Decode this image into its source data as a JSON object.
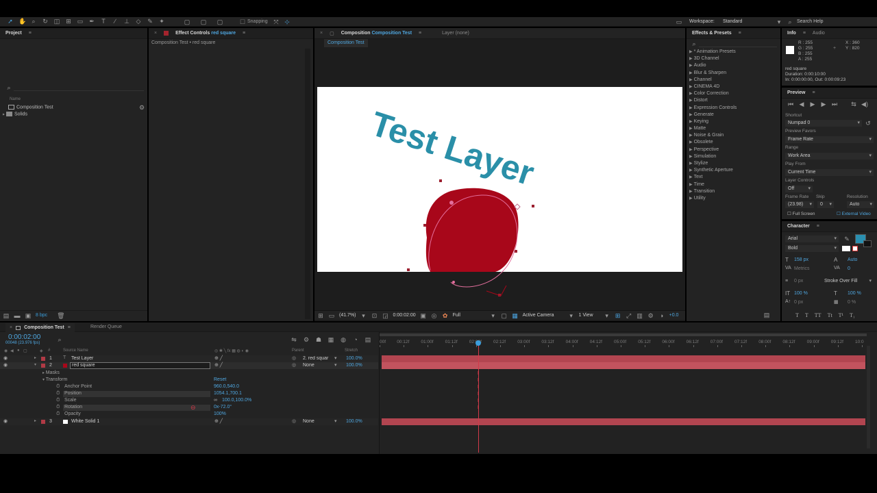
{
  "toolbar": {
    "snapping": "Snapping",
    "workspace_label": "Workspace:",
    "workspace_value": "Standard",
    "search_help": "Search Help"
  },
  "project": {
    "tab": "Project",
    "column_name": "Name",
    "items": [
      "Composition Test",
      "Solids"
    ],
    "bpc": "8 bpc"
  },
  "effect_controls": {
    "tab_prefix": "Effect Controls",
    "tab_layer": "red square",
    "subtitle": "Composition Test • red square"
  },
  "composition": {
    "tab_prefix": "Composition",
    "tab_name": "Composition Test",
    "layer_tab": "Layer (none)",
    "sub_tab": "Composition Test",
    "text_layer": "Test Layer",
    "zoom": "(41.7%)",
    "timecode": "0:00:02:00",
    "resolution": "Full",
    "camera": "Active Camera",
    "view": "1 View",
    "exposure": "+0.0"
  },
  "effects_presets": {
    "tab": "Effects & Presets",
    "items": [
      "* Animation Presets",
      "3D Channel",
      "Audio",
      "Blur & Sharpen",
      "Channel",
      "CINEMA 4D",
      "Color Correction",
      "Distort",
      "Expression Controls",
      "Generate",
      "Keying",
      "Matte",
      "Noise & Grain",
      "Obsolete",
      "Perspective",
      "Simulation",
      "Stylize",
      "Synthetic Aperture",
      "Text",
      "Time",
      "Transition",
      "Utility"
    ]
  },
  "info": {
    "tab": "Info",
    "audio_tab": "Audio",
    "r": "R : 255",
    "g": "G : 255",
    "b": "B : 255",
    "a": "A : 255",
    "x": "X : 360",
    "y": "Y : 820",
    "layer_name": "red square",
    "duration": "Duration: 0:00:10:00",
    "in_out": "In: 0:00:00:00, Out: 0:00:09:23"
  },
  "preview": {
    "tab": "Preview",
    "shortcut_label": "Shortcut",
    "shortcut_value": "Numpad 0",
    "favors_label": "Preview Favors",
    "favors_value": "Frame Rate",
    "range_label": "Range",
    "range_value": "Work Area",
    "play_from_label": "Play From",
    "play_from_value": "Current Time",
    "layer_controls_label": "Layer Controls",
    "layer_controls_value": "Off",
    "frame_rate_label": "Frame Rate",
    "skip_label": "Skip",
    "resolution_label": "Resolution",
    "frame_rate_value": "(23.98)",
    "skip_value": "0",
    "resolution_value": "Auto",
    "full_screen": "Full Screen",
    "external_video": "External Video"
  },
  "character": {
    "tab": "Character",
    "font": "Arial",
    "style": "Bold",
    "size": "158 px",
    "leading": "Auto",
    "kerning": "Metrics",
    "tracking": "0",
    "stroke_width": "0 px",
    "stroke_mode": "Stroke Over Fill",
    "vscale": "100 %",
    "hscale": "100 %",
    "baseline": "0 px",
    "tsume": "0 %",
    "fill_color": "#2a8fb0"
  },
  "timeline": {
    "tab": "Composition Test",
    "render_queue": "Render Queue",
    "timecode": "0:00:02:00",
    "frames": "00048 (23.976 fps)",
    "headers": {
      "source": "Source Name",
      "parent": "Parent",
      "stretch": "Stretch"
    },
    "layers": [
      {
        "num": "1",
        "name": "Test Layer",
        "parent": "2. red squar",
        "stretch": "100.0%"
      },
      {
        "num": "2",
        "name": "red square",
        "parent": "None",
        "stretch": "100.0%"
      },
      {
        "num": "3",
        "name": "White Solid 1",
        "parent": "None",
        "stretch": "100.0%"
      }
    ],
    "masks": "Masks",
    "transform": "Transform",
    "reset": "Reset",
    "props": [
      {
        "name": "Anchor Point",
        "value": "960.0,540.0"
      },
      {
        "name": "Position",
        "value": "1054.1,700.1"
      },
      {
        "name": "Scale",
        "value": "100.0,100.0%"
      },
      {
        "name": "Rotation",
        "value": "0x-72.0°"
      },
      {
        "name": "Opacity",
        "value": "100%"
      }
    ],
    "ruler": [
      "00f",
      "00:12f",
      "01:00f",
      "01:12f",
      "02:00f",
      "02:12f",
      "03:00f",
      "03:12f",
      "04:00f",
      "04:12f",
      "05:00f",
      "05:12f",
      "06:00f",
      "06:12f",
      "07:00f",
      "07:12f",
      "08:00f",
      "08:12f",
      "09:00f",
      "09:12f",
      "10:0"
    ],
    "playhead_fraction": 0.2
  },
  "colors": {
    "accent": "#3b9edc",
    "layer_red": "#b03a45",
    "shape_red": "#a8071a",
    "text_teal": "#2a8fa8"
  }
}
